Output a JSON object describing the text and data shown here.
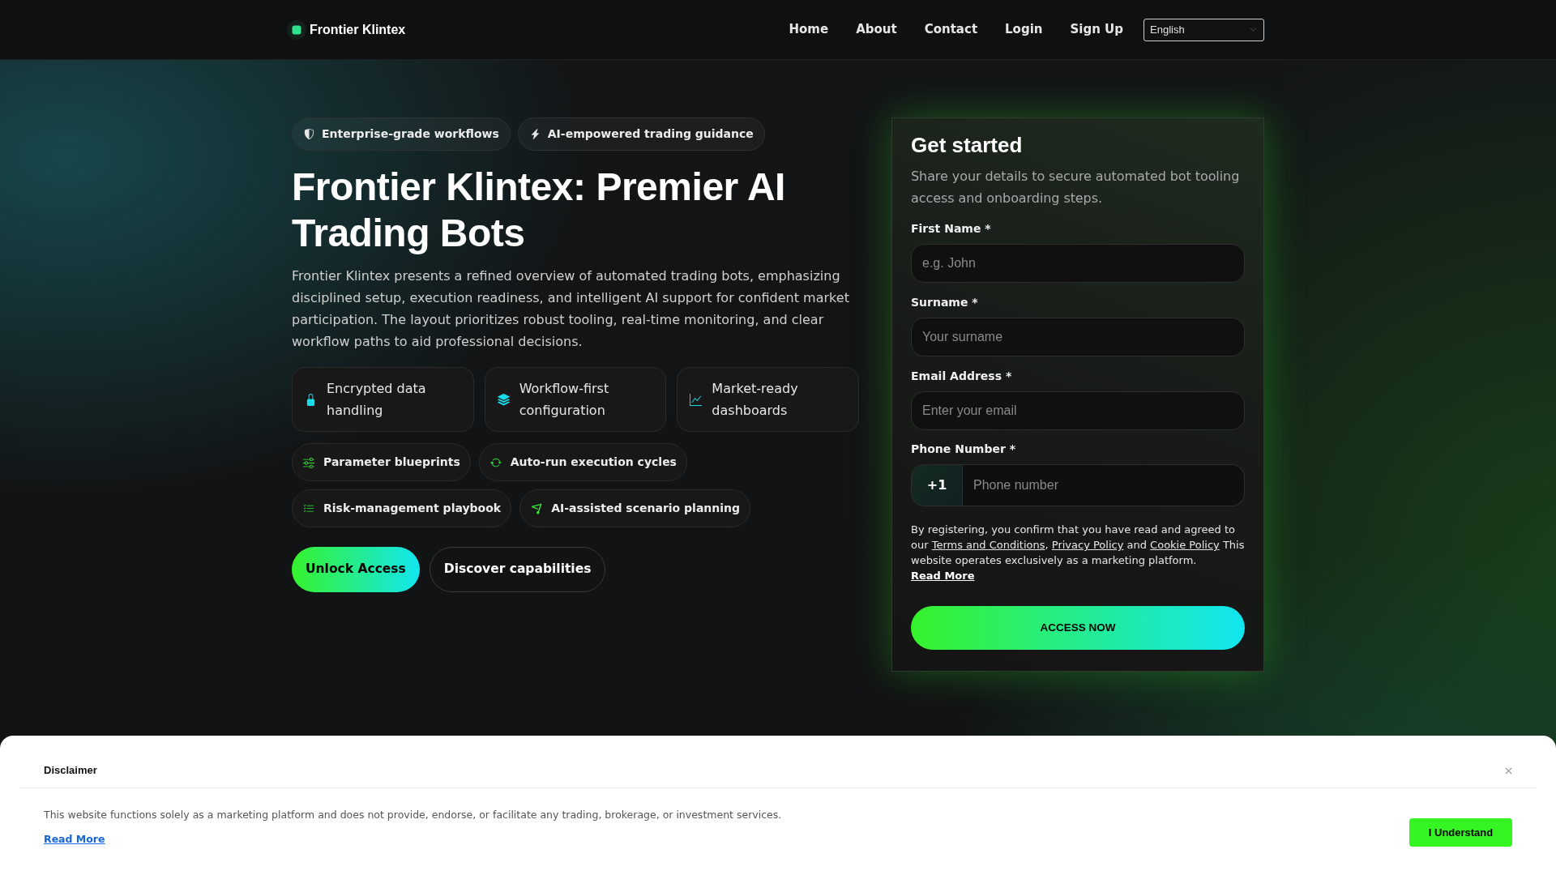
{
  "header": {
    "brand": "Frontier Klintex",
    "nav": [
      {
        "label": "Home"
      },
      {
        "label": "About"
      },
      {
        "label": "Contact"
      },
      {
        "label": "Login"
      },
      {
        "label": "Sign Up"
      }
    ],
    "language": {
      "value": "English"
    }
  },
  "hero": {
    "badges": [
      "Enterprise-grade workflows",
      "AI-empowered trading guidance"
    ],
    "title": "Frontier Klintex: Premier AI Trading Bots",
    "description": "Frontier Klintex presents a refined overview of automated trading bots, emphasizing disciplined setup, execution readiness, and intelligent AI support for confident market participation. The layout prioritizes robust tooling, real-time monitoring, and clear workflow paths to aid professional decisions.",
    "features": [
      "Encrypted data handling",
      "Workflow-first configuration",
      "Market-ready dashboards"
    ],
    "capabilities": [
      "Parameter blueprints",
      "Auto-run execution cycles",
      "Risk-management playbook",
      "AI-assisted scenario planning"
    ],
    "buttons": [
      {
        "label": "Unlock Access",
        "kind": "primary"
      },
      {
        "label": "Discover capabilities",
        "kind": "secondary"
      }
    ]
  },
  "form": {
    "title": "Get started",
    "subtitle": "Share your details to secure automated bot tooling access and onboarding steps.",
    "fields": [
      {
        "kind": "text",
        "label": "First Name *",
        "placeholder": "e.g. John"
      },
      {
        "kind": "text",
        "label": "Surname *",
        "placeholder": "Your surname"
      },
      {
        "kind": "text",
        "label": "Email Address *",
        "placeholder": "Enter your email"
      },
      {
        "kind": "phone",
        "label": "Phone Number *",
        "prefix": "+1",
        "placeholder": "Phone number"
      }
    ],
    "consent": [
      {
        "kind": "text",
        "text": "By registering, you confirm that you have read and agreed to our "
      },
      {
        "kind": "link",
        "text": "Terms and Conditions"
      },
      {
        "kind": "text",
        "text": ", "
      },
      {
        "kind": "link",
        "text": "Privacy Policy"
      },
      {
        "kind": "text",
        "text": " and "
      },
      {
        "kind": "link",
        "text": "Cookie Policy"
      },
      {
        "kind": "text",
        "text": " This website operates exclusively as a marketing platform. "
      },
      {
        "kind": "strong_link",
        "text": "Read More"
      }
    ],
    "submit": "ACCESS NOW"
  },
  "disclaimer": {
    "title": "Disclaimer",
    "text": "This website functions solely as a marketing platform and does not provide, endorse, or facilitate any trading, brokerage, or investment services.",
    "link": "Read More",
    "button": "I Understand"
  }
}
